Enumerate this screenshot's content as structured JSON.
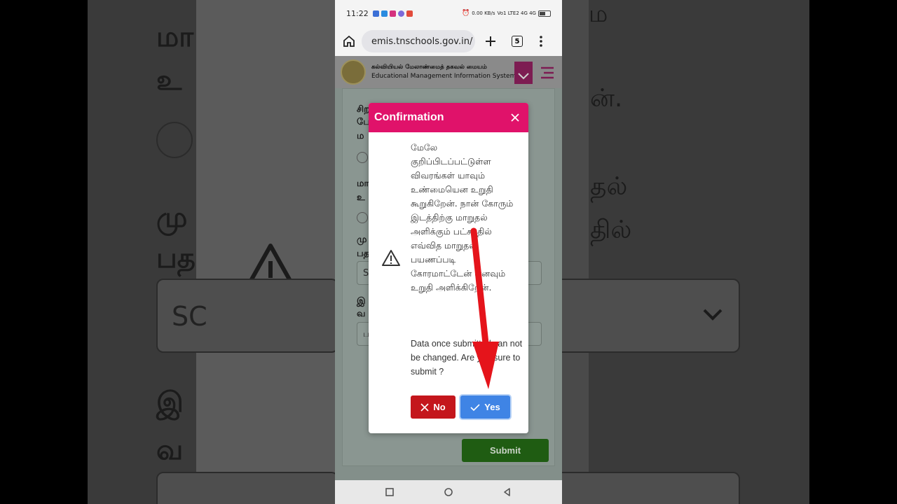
{
  "statusbar": {
    "time": "11:22",
    "net_speed": "0.00 KB/s",
    "signal_labels": "Vo1 LTE2 4G 4G"
  },
  "browser": {
    "url": "emis.tnschools.gov.in/",
    "tab_count": "5"
  },
  "site": {
    "title_ta": "கல்வியியல் மேலாண்மைத் தகவல் மையம்",
    "title_en": "Educational Management Information System"
  },
  "background_form": {
    "q1": "சிற",
    "q1b": "பே",
    "q1c": "ம",
    "q2": "மா",
    "q2b": "உ",
    "q3": "மு",
    "q3b": "பத",
    "select1": "SC",
    "q4": "இ",
    "q4b": "வ",
    "select2": "ப",
    "submit_label": "Submit"
  },
  "modal": {
    "title": "Confirmation",
    "message_ta": "மேலே குறிப்பிடப்பட்டுள்ள விவரங்கள் யாவும் உண்மையென உறுதி கூறுகிறேன். நான் கோரும் இடத்திற்கு மாறுதல் அளிக்கும் பட்சத்தில் எவ்வித மாறுதல் பயணப்படி கோரமாட்டேன் எனவும் உறுதி அளிக்கிறேன்.",
    "message_en": "Data once submitted can not be changed. Are you sure to submit ?",
    "no_label": "No",
    "yes_label": "Yes"
  },
  "side_bg": {
    "left_1": "மா",
    "left_2": "உ",
    "left_3": "மு",
    "left_4": "பத",
    "left_5": "SC",
    "left_6": "இ",
    "left_7": "வ",
    "right_1": "ம",
    "right_2": "ன்.",
    "right_3": "தல்",
    "right_4": "தில்"
  },
  "colors": {
    "modal_header": "#e0126a",
    "no_button": "#c4161c",
    "yes_button": "#3f84e5",
    "submit_button": "#1f5c12",
    "annotation_arrow": "#e5141b"
  },
  "icons": [
    "home-icon",
    "site-info-icon",
    "plus-icon",
    "more-vert-icon",
    "close-icon",
    "warning-icon",
    "x-icon",
    "check-icon",
    "chevron-down-icon",
    "hamburger-icon",
    "nav-square-icon",
    "nav-circle-icon",
    "nav-back-icon"
  ]
}
